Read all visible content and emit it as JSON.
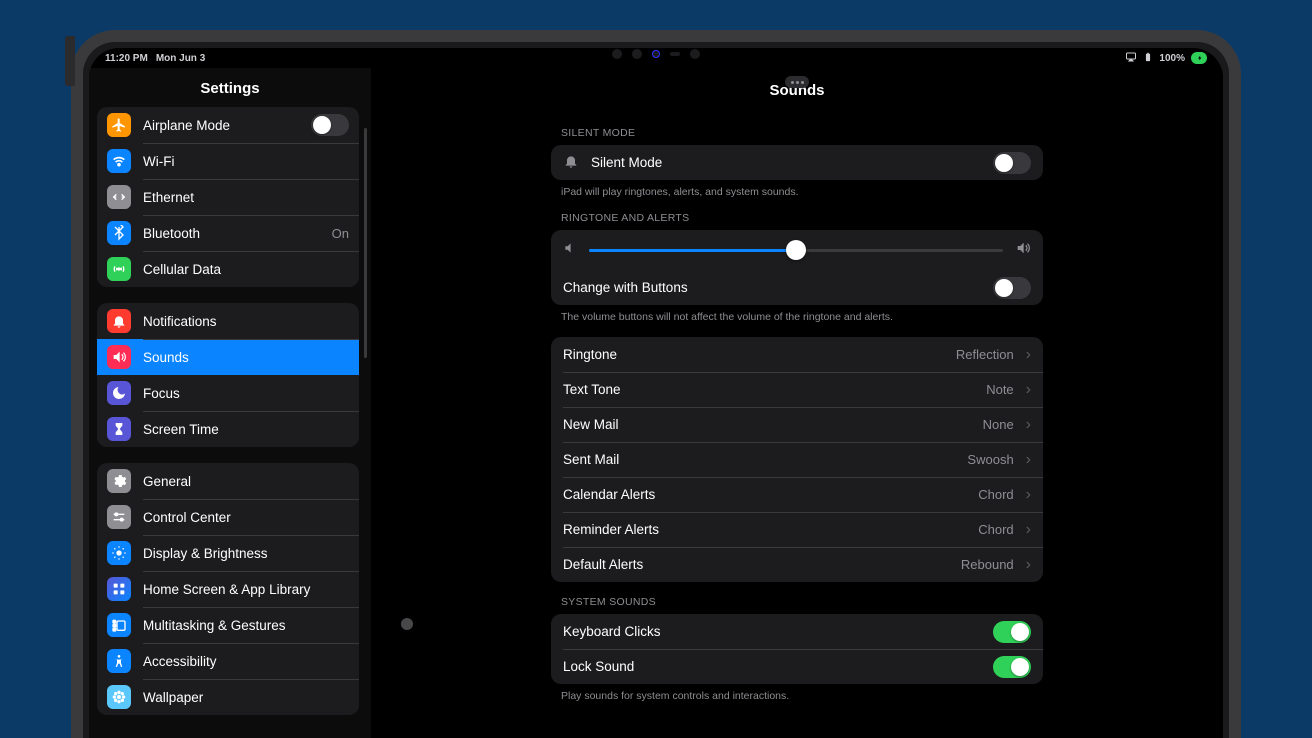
{
  "statusbar": {
    "time": "11:20 PM",
    "date": "Mon Jun 3",
    "battery": "100%"
  },
  "sidebar": {
    "title": "Settings",
    "g1": {
      "airplane": "Airplane Mode",
      "wifi": "Wi-Fi",
      "ethernet": "Ethernet",
      "bluetooth": "Bluetooth",
      "bluetooth_value": "On",
      "cellular": "Cellular Data"
    },
    "g2": {
      "notifications": "Notifications",
      "sounds": "Sounds",
      "focus": "Focus",
      "screentime": "Screen Time"
    },
    "g3": {
      "general": "General",
      "controlcenter": "Control Center",
      "display": "Display & Brightness",
      "home": "Home Screen & App Library",
      "multitask": "Multitasking & Gestures",
      "accessibility": "Accessibility",
      "wallpaper": "Wallpaper"
    }
  },
  "detail": {
    "title": "Sounds",
    "silent_header": "Silent Mode",
    "silent_label": "Silent Mode",
    "silent_footer": "iPad will play ringtones, alerts, and system sounds.",
    "ringalerts_header": "Ringtone and Alerts",
    "slider_percent": 50,
    "change_buttons": "Change with Buttons",
    "ringalerts_footer": "The volume buttons will not affect the volume of the ringtone and alerts.",
    "tones": {
      "ringtone": "Ringtone",
      "ringtone_v": "Reflection",
      "text": "Text Tone",
      "text_v": "Note",
      "newmail": "New Mail",
      "newmail_v": "None",
      "sentmail": "Sent Mail",
      "sentmail_v": "Swoosh",
      "cal": "Calendar Alerts",
      "cal_v": "Chord",
      "rem": "Reminder Alerts",
      "rem_v": "Chord",
      "def": "Default Alerts",
      "def_v": "Rebound"
    },
    "system_header": "System Sounds",
    "keyboard": "Keyboard Clicks",
    "lock": "Lock Sound",
    "system_footer": "Play sounds for system controls and interactions."
  }
}
